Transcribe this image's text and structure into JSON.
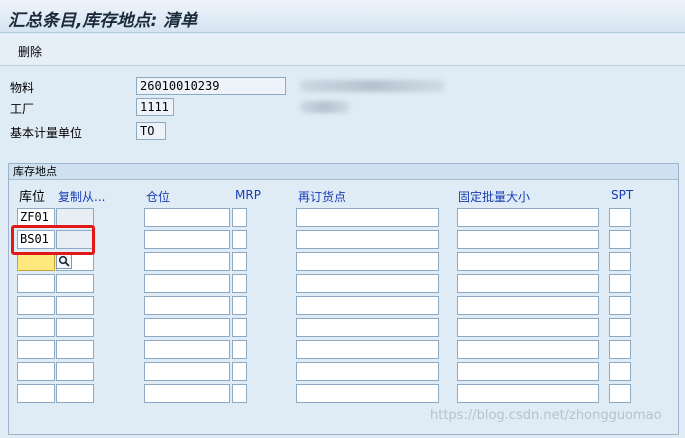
{
  "window": {
    "title": "汇总条目,库存地点: 清单"
  },
  "toolbar": {
    "delete_label": "删除"
  },
  "header": {
    "material_label": "物料",
    "material_value": "26010010239",
    "plant_label": "工厂",
    "plant_value": "1111",
    "uom_label": "基本计量单位",
    "uom_value": "TO"
  },
  "storage_group": {
    "title": "库存地点",
    "columns": {
      "sloc": "库位",
      "copy_from": "复制从...",
      "warehouse": "仓位",
      "mrp": "MRP",
      "reorder_point": "再订货点",
      "fixed_lot": "固定批量大小",
      "spt": "SPT"
    },
    "rows": [
      {
        "sloc": "ZF01"
      },
      {
        "sloc": "BS01"
      },
      {
        "sloc": ""
      },
      {
        "sloc": ""
      },
      {
        "sloc": ""
      },
      {
        "sloc": ""
      },
      {
        "sloc": ""
      },
      {
        "sloc": ""
      },
      {
        "sloc": ""
      }
    ]
  },
  "watermark": "https://blog.csdn.net/zhongguomao",
  "colors": {
    "highlight_box": "#e01818",
    "active_cell": "#ffe97f",
    "link_header": "#1a3cb4"
  },
  "icons": {
    "search": "magnifier-icon"
  }
}
